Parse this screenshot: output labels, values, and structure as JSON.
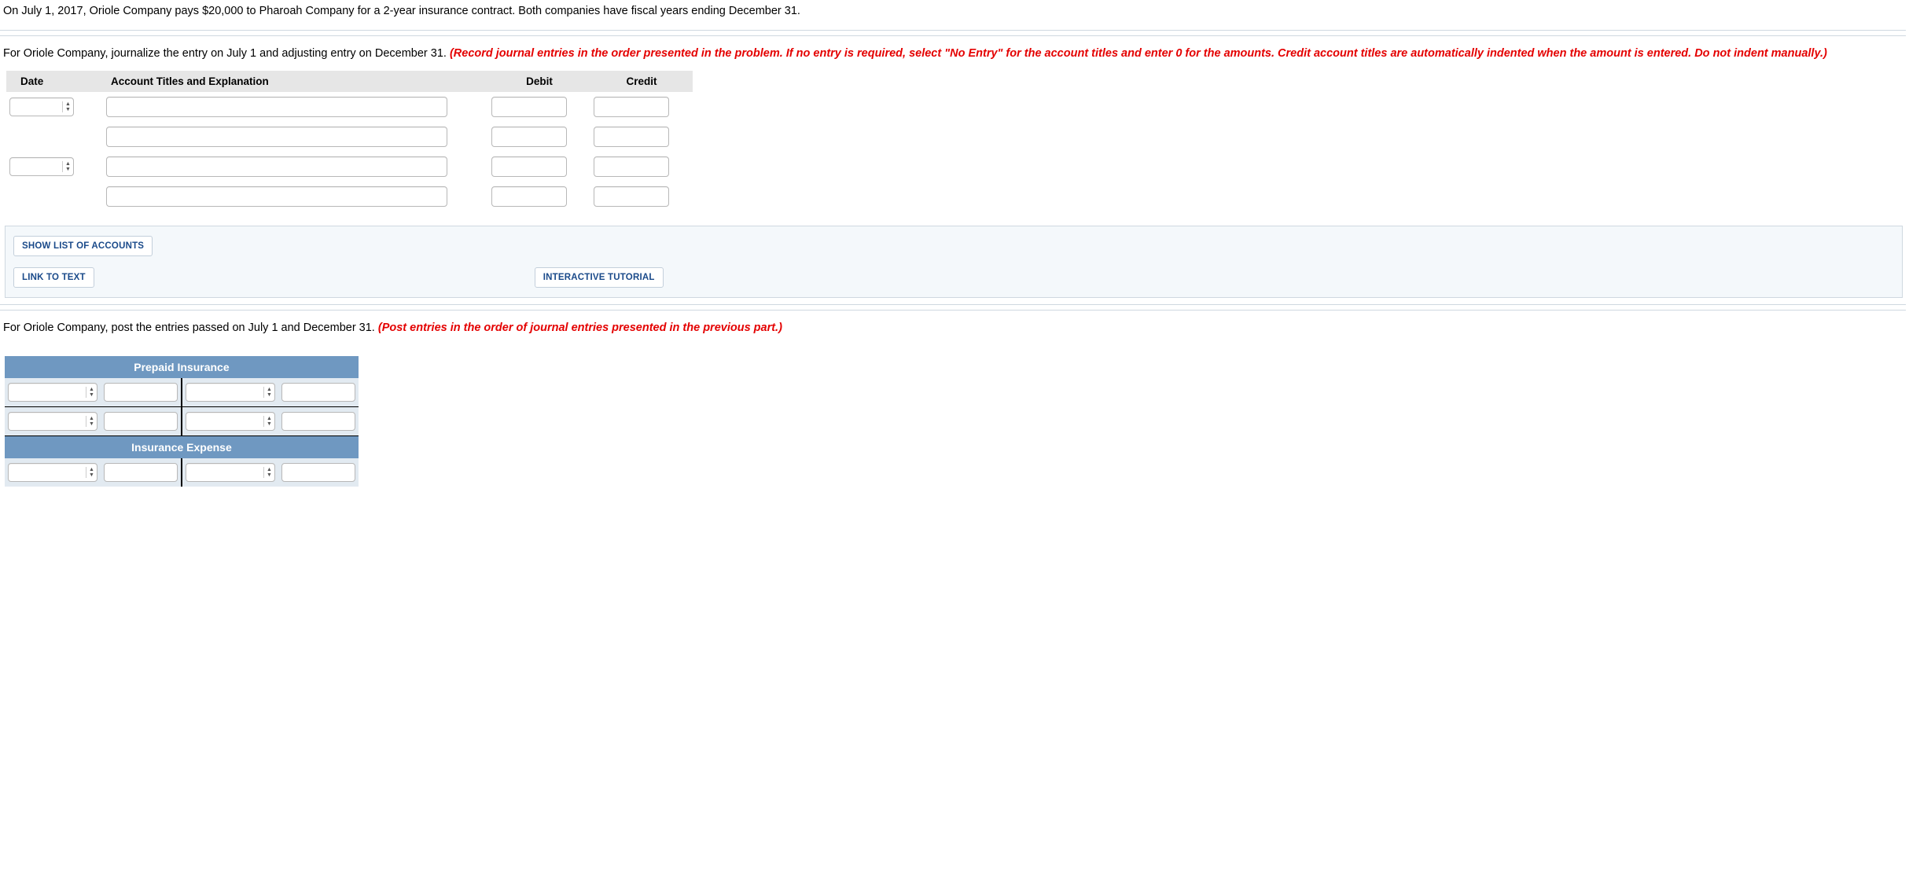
{
  "problem_text": "On July 1, 2017, Oriole Company pays $20,000 to Pharoah Company for a 2-year insurance contract. Both companies have fiscal years ending December 31.",
  "section1": {
    "lead_in": "For Oriole Company, journalize the entry on July 1 and adjusting entry on December 31. ",
    "red": "(Record journal entries in the order presented in the problem. If no entry is required, select \"No Entry\" for the account titles and enter 0 for the amounts. Credit account titles are automatically indented when the amount is entered. Do not indent manually.)"
  },
  "journal": {
    "headers": {
      "date": "Date",
      "acct": "Account Titles and Explanation",
      "debit": "Debit",
      "credit": "Credit"
    }
  },
  "links": {
    "show_accounts": "SHOW LIST OF ACCOUNTS",
    "link_text": "LINK TO TEXT",
    "tutorial": "INTERACTIVE TUTORIAL"
  },
  "section2": {
    "lead_in": "For Oriole Company, post the entries passed on July 1 and December 31. ",
    "red": "(Post entries in the order of journal entries presented in the previous part.)"
  },
  "taccounts": {
    "prepaid": "Prepaid Insurance",
    "expense": "Insurance Expense"
  }
}
